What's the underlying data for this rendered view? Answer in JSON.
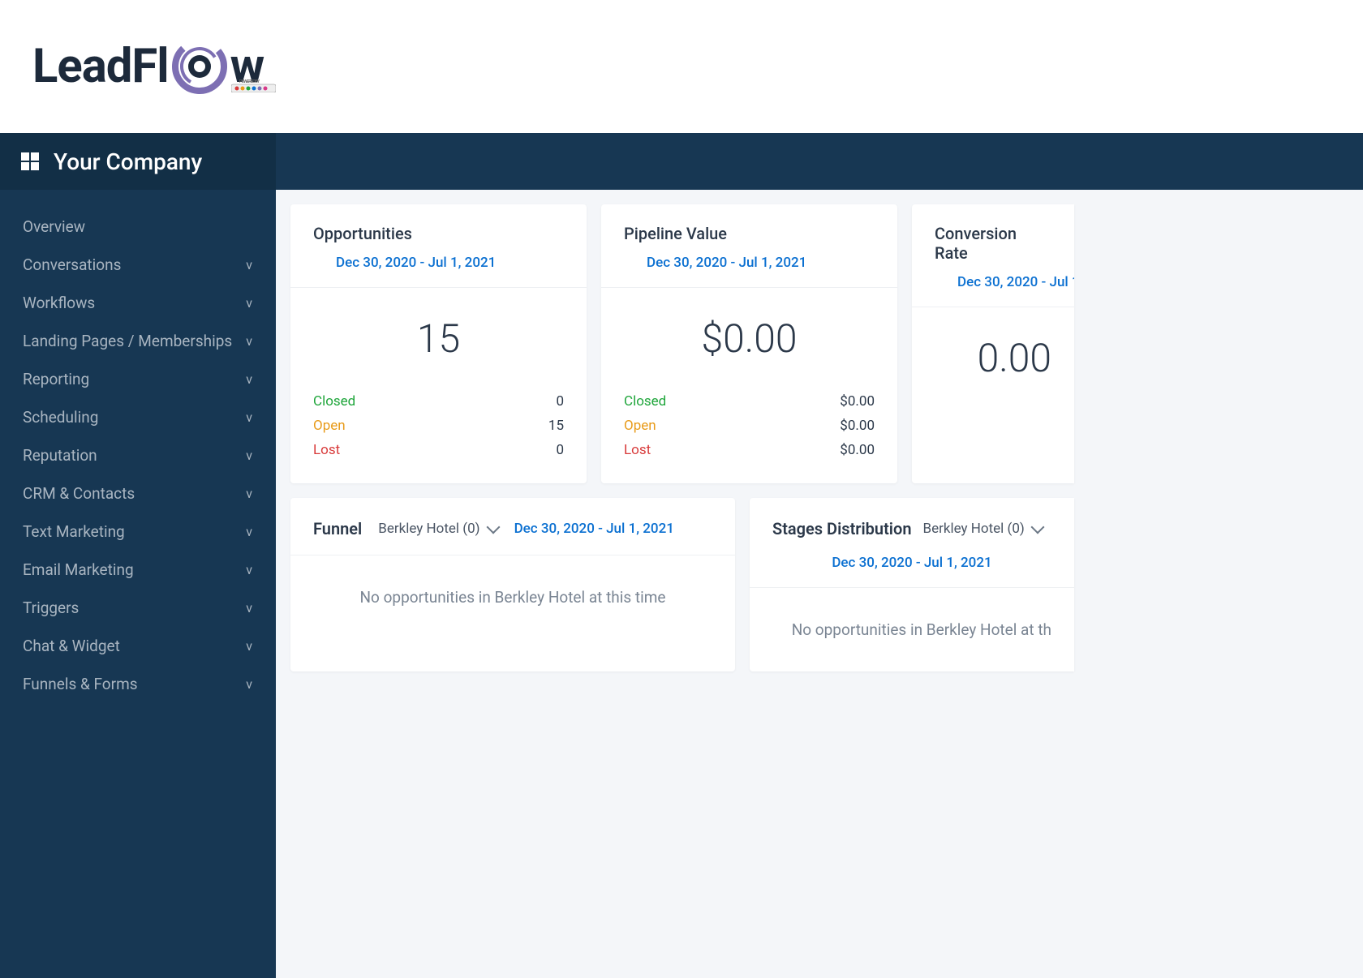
{
  "logo": {
    "text_lead": "LeadFl",
    "text_tail": "w"
  },
  "company": {
    "name": "Your Company"
  },
  "nav": {
    "items": [
      {
        "label": "Overview",
        "expandable": false
      },
      {
        "label": "Conversations",
        "expandable": true
      },
      {
        "label": "Workflows",
        "expandable": true
      },
      {
        "label": "Landing Pages / Memberships",
        "expandable": true
      },
      {
        "label": "Reporting",
        "expandable": true
      },
      {
        "label": "Scheduling",
        "expandable": true
      },
      {
        "label": "Reputation",
        "expandable": true
      },
      {
        "label": "CRM & Contacts",
        "expandable": true
      },
      {
        "label": "Text Marketing",
        "expandable": true
      },
      {
        "label": "Email Marketing",
        "expandable": true
      },
      {
        "label": "Triggers",
        "expandable": true
      },
      {
        "label": "Chat & Widget",
        "expandable": true
      },
      {
        "label": "Funnels & Forms",
        "expandable": true
      }
    ]
  },
  "date_range": "Dec 30, 2020 - Jul 1, 2021",
  "cards": {
    "opportunities": {
      "title": "Opportunities",
      "value": "15",
      "breakdown": {
        "closed_label": "Closed",
        "closed_value": "0",
        "open_label": "Open",
        "open_value": "15",
        "lost_label": "Lost",
        "lost_value": "0"
      }
    },
    "pipeline": {
      "title": "Pipeline Value",
      "value": "$0.00",
      "breakdown": {
        "closed_label": "Closed",
        "closed_value": "$0.00",
        "open_label": "Open",
        "open_value": "$0.00",
        "lost_label": "Lost",
        "lost_value": "$0.00"
      }
    },
    "conversion": {
      "title": "Conversion Rate",
      "value": "0.00"
    }
  },
  "funnel": {
    "title": "Funnel",
    "selected": "Berkley Hotel (0)",
    "empty_msg": "No opportunities in Berkley Hotel at this time"
  },
  "stages": {
    "title": "Stages Distribution",
    "selected": "Berkley Hotel (0)",
    "empty_msg": "No opportunities in Berkley Hotel at th"
  }
}
